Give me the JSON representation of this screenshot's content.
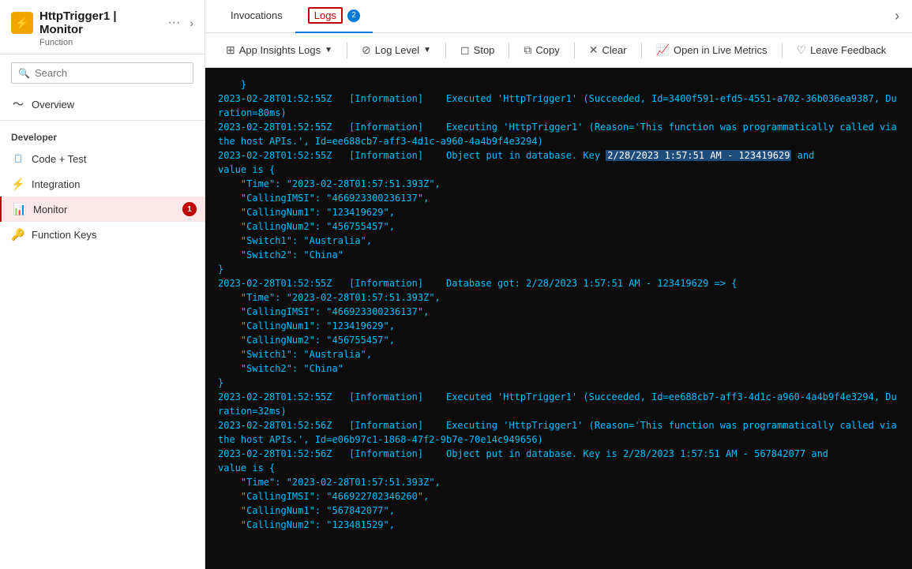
{
  "header": {
    "title": "HttpTrigger1 | Monitor",
    "subtitle": "Function",
    "more_label": "···",
    "expand_label": "›"
  },
  "sidebar": {
    "search_placeholder": "Search",
    "collapse_icon": "«",
    "nav": {
      "overview_label": "Overview",
      "developer_label": "Developer",
      "items": [
        {
          "id": "code-test",
          "label": "Code + Test",
          "icon": "💻",
          "active": false
        },
        {
          "id": "integration",
          "label": "Integration",
          "icon": "⚡",
          "active": false
        },
        {
          "id": "monitor",
          "label": "Monitor",
          "icon": "📊",
          "active": true,
          "badge": "1"
        },
        {
          "id": "function-keys",
          "label": "Function Keys",
          "icon": "🔑",
          "active": false
        }
      ]
    }
  },
  "tabs": [
    {
      "id": "invocations",
      "label": "Invocations",
      "active": false,
      "badge": null
    },
    {
      "id": "logs",
      "label": "Logs",
      "active": true,
      "badge": "2"
    }
  ],
  "toolbar": {
    "app_insights_logs": "App Insights Logs",
    "log_level": "Log Level",
    "stop": "Stop",
    "copy": "Copy",
    "clear": "Clear",
    "open_live_metrics": "Open in Live Metrics",
    "leave_feedback": "Leave Feedback"
  },
  "log_content": {
    "lines": [
      "    }",
      "2023-02-28T01:52:55Z   [Information]    Executed 'HttpTrigger1' (Succeeded, Id=3400f591-efd5-4551-a702-36b036ea9387, Duration=80ms)",
      "2023-02-28T01:52:55Z   [Information]    Executing 'HttpTrigger1' (Reason='This function was programmatically called via the host APIs.', Id=ee688cb7-aff3-4d1c-a960-4a4b9f4e3294)",
      "2023-02-28T01:52:55Z   [Information]    Object put in database. Key ",
      "HIGHLIGHT:2/28/2023 1:57:51 AM - 123419629",
      " and",
      "value is {",
      "    \"Time\": \"2023-02-28T01:57:51.393Z\",",
      "    \"CallingIMSI\": \"466923300236137\",",
      "    \"CallingNum1\": \"123419629\",",
      "    \"CallingNum2\": \"456755457\",",
      "    \"Switch1\": \"Australia\",",
      "    \"Switch2\": \"China\"",
      "}",
      "2023-02-28T01:52:55Z   [Information]    Database got: 2/28/2023 1:57:51 AM - 123419629 => {",
      "    \"Time\": \"2023-02-28T01:57:51.393Z\",",
      "    \"CallingIMSI\": \"466923300236137\",",
      "    \"CallingNum1\": \"123419629\",",
      "    \"CallingNum2\": \"456755457\",",
      "    \"Switch1\": \"Australia\",",
      "    \"Switch2\": \"China\"",
      "}",
      "2023-02-28T01:52:55Z   [Information]    Executed 'HttpTrigger1' (Succeeded, Id=ee688cb7-aff3-4d1c-a960-4a4b9f4e3294, Duration=32ms)",
      "2023-02-28T01:52:56Z   [Information]    Executing 'HttpTrigger1' (Reason='This function was programmatically called via the host APIs.', Id=e06b97c1-1868-47f2-9b7e-70e14c949656)",
      "2023-02-28T01:52:56Z   [Information]    Object put in database. Key is 2/28/2023 1:57:51 AM - 567842077 and",
      "value is {",
      "    \"Time\": \"2023-02-28T01:57:51.393Z\",",
      "    \"CallingIMSI\": \"466922702346260\",",
      "    \"CallingNum1\": \"567842077\",",
      "    \"CallingNum2\": \"123481529\","
    ],
    "highlight_text": "2/28/2023 1:57:51 AM - 123419629"
  }
}
